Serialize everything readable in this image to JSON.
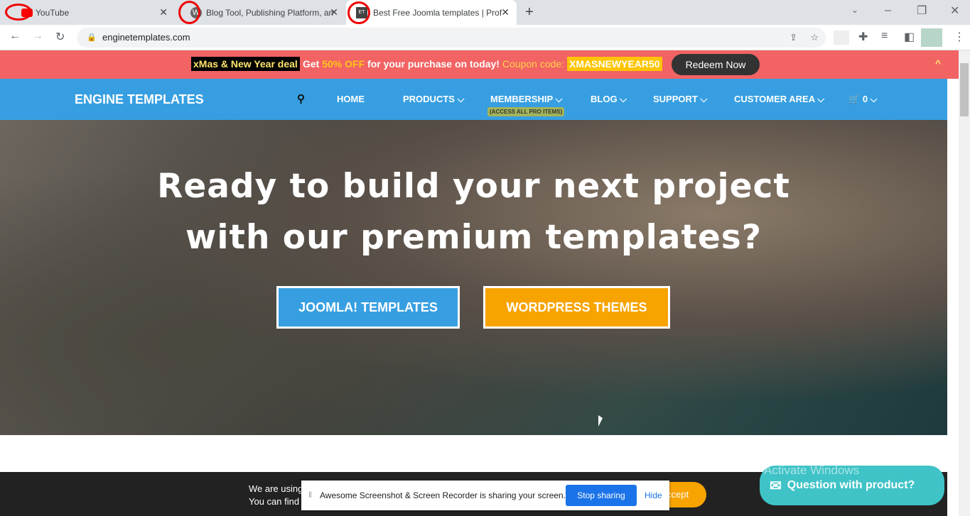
{
  "browser": {
    "tabs": [
      {
        "title": "YouTube",
        "icon": "youtube-icon"
      },
      {
        "title": "Blog Tool, Publishing Platform, an",
        "icon": "wordpress-icon"
      },
      {
        "title": "Best Free Joomla templates | Prof",
        "icon": "et-icon",
        "favicon_text": "ET"
      }
    ],
    "url": "enginetemplates.com"
  },
  "promo": {
    "deal": "xMas & New Year deal",
    "get": "Get",
    "off": "50% OFF",
    "purchase": "for your purchase on today!",
    "coupon_label": "Coupon code:",
    "coupon": "XMASNEWYEAR50",
    "redeem": "Redeem Now"
  },
  "nav": {
    "logo": "ENGINE TEMPLATES",
    "items": [
      "HOME",
      "PRODUCTS",
      "MEMBERSHIP",
      "BLOG",
      "SUPPORT",
      "CUSTOMER AREA"
    ],
    "membership_badge": "(ACCESS ALL PRO ITEMS)",
    "cart_count": "0"
  },
  "hero": {
    "line1": "Ready to build your next project",
    "line2": "with our premium templates?",
    "joomla": "JOOMLA! TEMPLATES",
    "wordpress": "WORDPRESS THEMES"
  },
  "cookie": {
    "line1": "We are using",
    "line2": "You can find",
    "accept": "ccept"
  },
  "share": {
    "text": "Awesome Screenshot & Screen Recorder is sharing your screen.",
    "stop": "Stop sharing",
    "hide": "Hide"
  },
  "chat": {
    "label": "Question with product?"
  },
  "watermark": "Activate Windows",
  "colors": {
    "promo": "#f26363",
    "nav": "#379fe1",
    "joomla": "#379fe1",
    "wordpress": "#f7a300",
    "chat": "#3fc3c7"
  }
}
